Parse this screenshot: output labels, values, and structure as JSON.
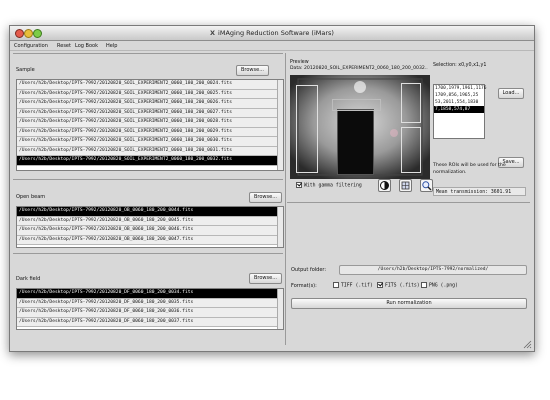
{
  "window": {
    "title": "iMAging Reduction Software (iMars)"
  },
  "menu": [
    "Configuration",
    "Reset",
    "Log Book",
    "Help"
  ],
  "sample": {
    "label": "Sample",
    "browse": "Browse...",
    "files": [
      "/Users/h2b/Desktop/IPTS-7992/20120820_SOIL_EXPERIMENT2_0060_180_200_0024.fits",
      "/Users/h2b/Desktop/IPTS-7992/20120820_SOIL_EXPERIMENT2_0060_180_200_0025.fits",
      "/Users/h2b/Desktop/IPTS-7992/20120820_SOIL_EXPERIMENT2_0060_180_200_0026.fits",
      "/Users/h2b/Desktop/IPTS-7992/20120820_SOIL_EXPERIMENT2_0060_180_200_0027.fits",
      "/Users/h2b/Desktop/IPTS-7992/20120820_SOIL_EXPERIMENT2_0060_180_200_0028.fits",
      "/Users/h2b/Desktop/IPTS-7992/20120820_SOIL_EXPERIMENT2_0060_180_200_0029.fits",
      "/Users/h2b/Desktop/IPTS-7992/20120820_SOIL_EXPERIMENT2_0060_180_200_0030.fits",
      "/Users/h2b/Desktop/IPTS-7992/20120820_SOIL_EXPERIMENT2_0060_180_200_0031.fits",
      "/Users/h2b/Desktop/IPTS-7992/20120820_SOIL_EXPERIMENT2_0060_180_200_0032.fits"
    ]
  },
  "open_beam": {
    "label": "Open beam",
    "browse": "Browse...",
    "files": [
      "/Users/h2b/Desktop/IPTS-7992/20120820_OB_0060_180_200_0044.fits",
      "/Users/h2b/Desktop/IPTS-7992/20120820_OB_0060_180_200_0045.fits",
      "/Users/h2b/Desktop/IPTS-7992/20120820_OB_0060_180_200_0046.fits",
      "/Users/h2b/Desktop/IPTS-7992/20120820_OB_0060_180_200_0047.fits"
    ]
  },
  "dark_field": {
    "label": "Dark field",
    "browse": "Browse...",
    "files": [
      "/Users/h2b/Desktop/IPTS-7992/20120820_DF_0060_180_200_0034.fits",
      "/Users/h2b/Desktop/IPTS-7992/20120820_DF_0060_180_200_0035.fits",
      "/Users/h2b/Desktop/IPTS-7992/20120820_DF_0060_180_200_0036.fits",
      "/Users/h2b/Desktop/IPTS-7992/20120820_DF_0060_180_200_0037.fits"
    ]
  },
  "preview": {
    "label": "Preview",
    "data_label": "Data: 20120820_SOIL_EXPERIMENT2_0060_180_200_0032..",
    "gamma_label": "With gamma filtering"
  },
  "selection": {
    "label": "Selection: x0,y0,x1,y1",
    "rois": [
      "1700,1979,1961,1176",
      "1709,856,1965,25",
      "53,2011,554,1830",
      "7,1858,574,87"
    ],
    "load": "Load...",
    "save": "Save...",
    "note": "These ROIs will be used for the normalization.",
    "mean_transmission": "Mean transmission: 3601.91"
  },
  "output": {
    "folder_label": "Output folder:",
    "folder_value": "/Users/h2b/Desktop/IPTS-7992/normalized/",
    "format_label": "Format(s):",
    "formats": [
      {
        "name": "TIFF (.tif)",
        "checked": false
      },
      {
        "name": "FITS (.fits)",
        "checked": true
      },
      {
        "name": "PNG (.png)",
        "checked": false
      }
    ],
    "run": "Run normalization"
  }
}
